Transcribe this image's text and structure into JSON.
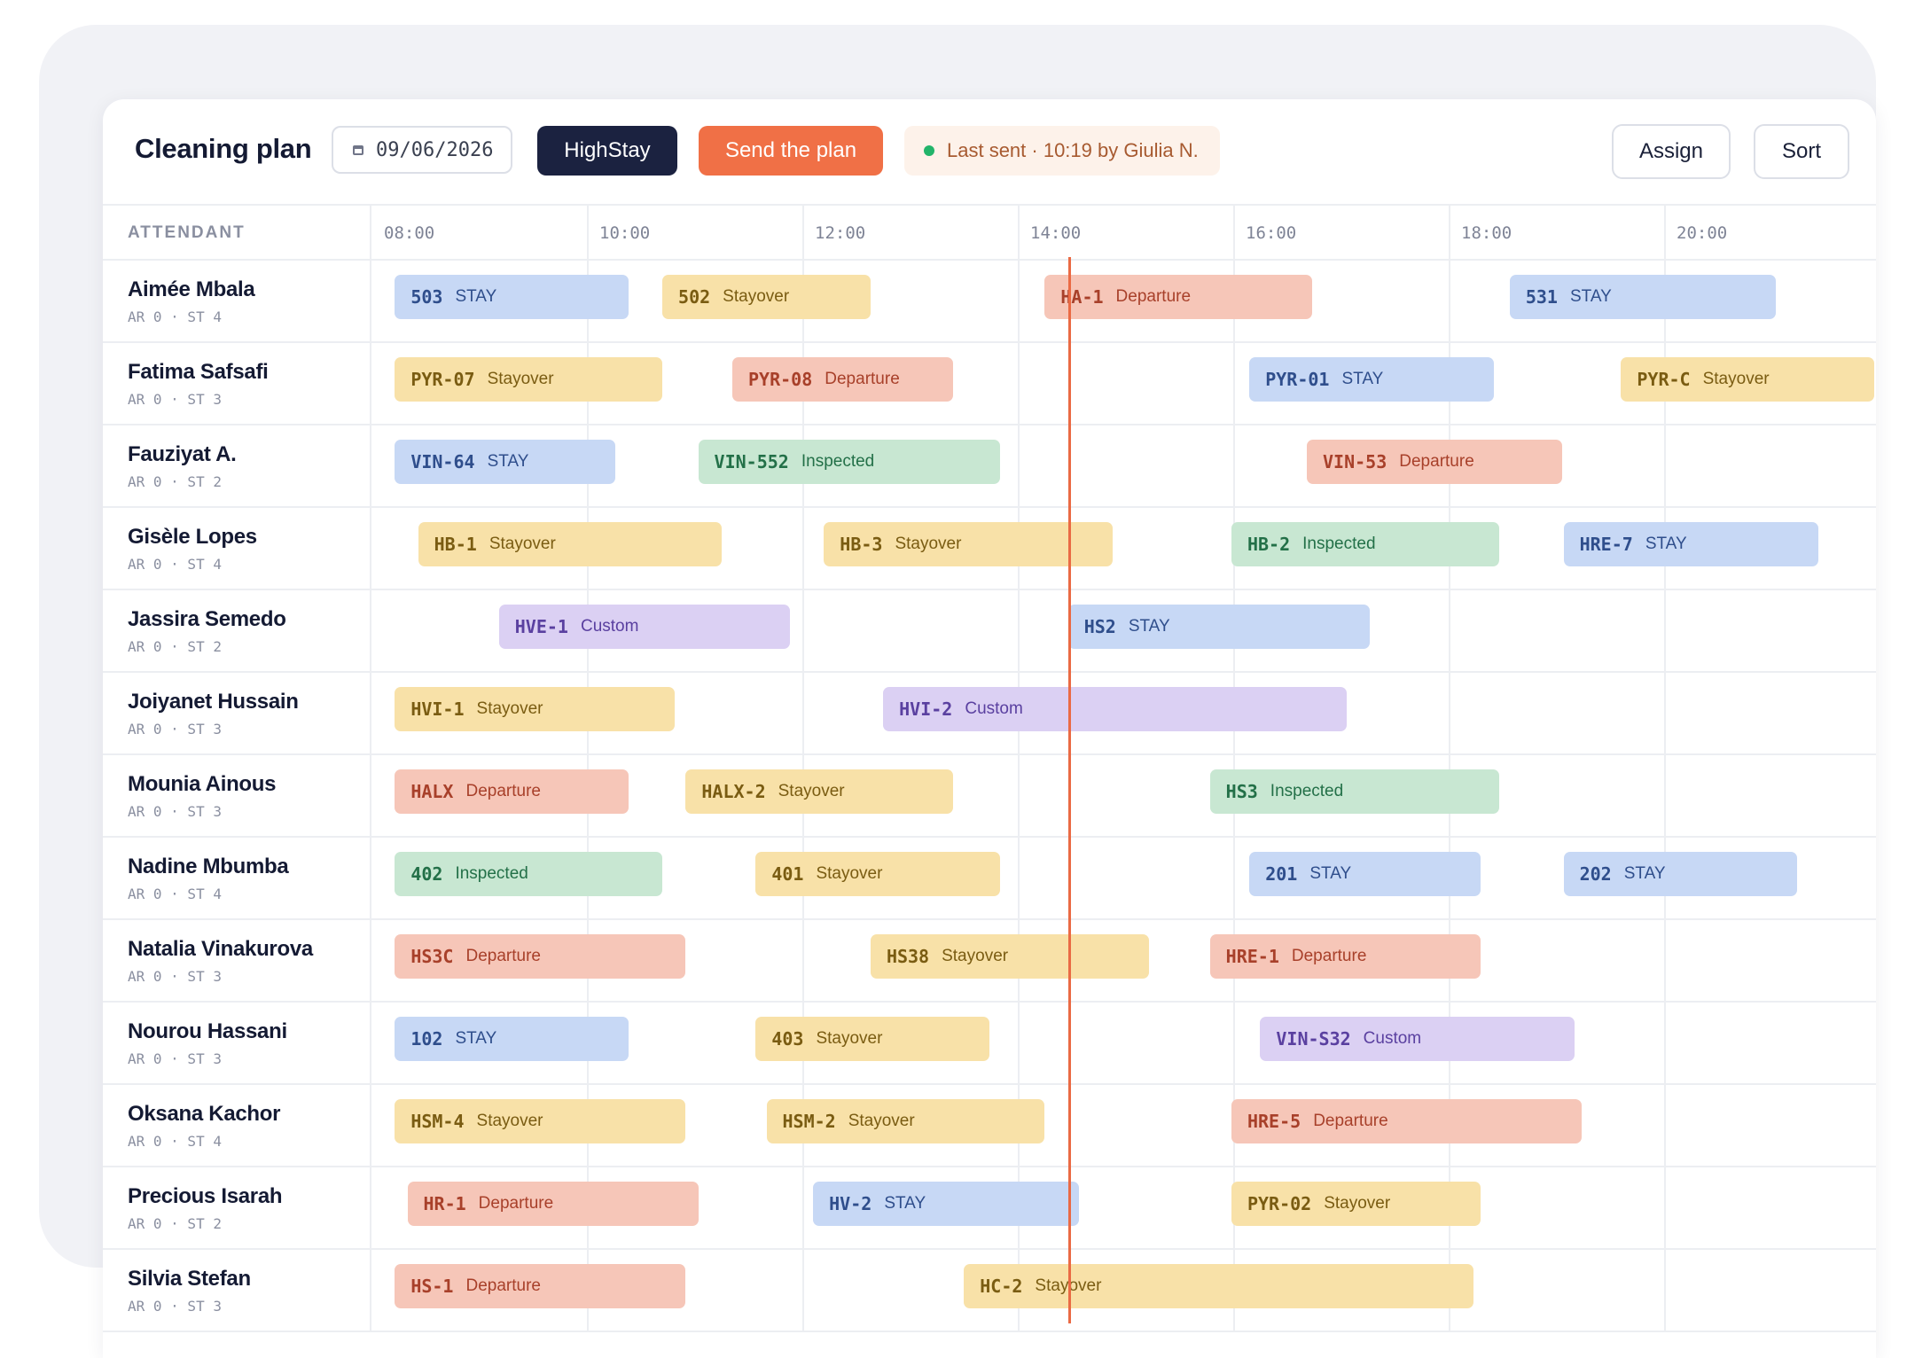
{
  "toolbar": {
    "title": "Cleaning plan",
    "date_value": "09/06/2026",
    "property_button": "HighStay",
    "send_button": "Send the plan",
    "last_sent": "Last sent · 10:19 by Giulia N.",
    "assign_button": "Assign",
    "sort_button": "Sort"
  },
  "header": {
    "attendant_label": "ATTENDANT",
    "times": [
      "08:00",
      "10:00",
      "12:00",
      "14:00",
      "16:00",
      "18:00",
      "20:00"
    ]
  },
  "legend_colors": {
    "STAY": "#c7d8f5",
    "Stayover": "#f8e1a8",
    "Departure": "#f6c6b8",
    "Inspected": "#c8e7d2",
    "Custom": "#dbd0f3",
    "current_time_line": "#ea6a44"
  },
  "attendants": [
    {
      "name": "Aimée Mbala",
      "meta": "AR 0 · ST 4",
      "tasks": [
        {
          "code": "503",
          "status": "STAY",
          "start": "08:13",
          "end": "10:23"
        },
        {
          "code": "502",
          "status": "Stayover",
          "start": "10:42",
          "end": "12:38"
        },
        {
          "code": "HA-1",
          "status": "Departure",
          "start": "14:15",
          "end": "16:44"
        },
        {
          "code": "531",
          "status": "STAY",
          "start": "18:34",
          "end": "21:02"
        }
      ]
    },
    {
      "name": "Fatima Safsafi",
      "meta": "AR 0 · ST 3",
      "tasks": [
        {
          "code": "PYR-07",
          "status": "Stayover",
          "start": "08:13",
          "end": "10:42"
        },
        {
          "code": "PYR-08",
          "status": "Departure",
          "start": "11:21",
          "end": "13:24"
        },
        {
          "code": "PYR-01",
          "status": "STAY",
          "start": "16:09",
          "end": "18:25"
        },
        {
          "code": "PYR-C",
          "status": "Stayover",
          "start": "19:36",
          "end": "21:57"
        }
      ]
    },
    {
      "name": "Fauziyat A.",
      "meta": "AR 0 · ST 2",
      "tasks": [
        {
          "code": "VIN-64",
          "status": "STAY",
          "start": "08:13",
          "end": "10:16"
        },
        {
          "code": "VIN-552",
          "status": "Inspected",
          "start": "11:02",
          "end": "13:50"
        },
        {
          "code": "VIN-53",
          "status": "Departure",
          "start": "16:41",
          "end": "19:03"
        }
      ]
    },
    {
      "name": "Gisèle Lopes",
      "meta": "AR 0 · ST 4",
      "tasks": [
        {
          "code": "HB-1",
          "status": "Stayover",
          "start": "08:26",
          "end": "11:15"
        },
        {
          "code": "HB-3",
          "status": "Stayover",
          "start": "12:12",
          "end": "14:53"
        },
        {
          "code": "HB-2",
          "status": "Inspected",
          "start": "15:59",
          "end": "18:28"
        },
        {
          "code": "HRE-7",
          "status": "STAY",
          "start": "19:04",
          "end": "21:26"
        }
      ]
    },
    {
      "name": "Jassira Semedo",
      "meta": "AR 0 · ST 2",
      "tasks": [
        {
          "code": "HVE-1",
          "status": "Custom",
          "start": "09:11",
          "end": "11:53"
        },
        {
          "code": "HS2",
          "status": "STAY",
          "start": "14:28",
          "end": "17:16"
        }
      ]
    },
    {
      "name": "Joiyanet Hussain",
      "meta": "AR 0 · ST 3",
      "tasks": [
        {
          "code": "HVI-1",
          "status": "Stayover",
          "start": "08:13",
          "end": "10:49"
        },
        {
          "code": "HVI-2",
          "status": "Custom",
          "start": "12:45",
          "end": "17:03"
        }
      ]
    },
    {
      "name": "Mounia Ainous",
      "meta": "AR 0 · ST 3",
      "tasks": [
        {
          "code": "HALX",
          "status": "Departure",
          "start": "08:13",
          "end": "10:23"
        },
        {
          "code": "HALX-2",
          "status": "Stayover",
          "start": "10:55",
          "end": "13:24"
        },
        {
          "code": "HS3",
          "status": "Inspected",
          "start": "15:47",
          "end": "18:28"
        }
      ]
    },
    {
      "name": "Nadine Mbumba",
      "meta": "AR 0 · ST 4",
      "tasks": [
        {
          "code": "402",
          "status": "Inspected",
          "start": "08:13",
          "end": "10:42"
        },
        {
          "code": "401",
          "status": "Stayover",
          "start": "11:34",
          "end": "13:50"
        },
        {
          "code": "201",
          "status": "STAY",
          "start": "16:09",
          "end": "18:18"
        },
        {
          "code": "202",
          "status": "STAY",
          "start": "19:04",
          "end": "21:14"
        }
      ]
    },
    {
      "name": "Natalia Vinakurova",
      "meta": "AR 0 · ST 3",
      "tasks": [
        {
          "code": "HS3C",
          "status": "Departure",
          "start": "08:13",
          "end": "10:55"
        },
        {
          "code": "HS38",
          "status": "Stayover",
          "start": "12:38",
          "end": "15:13"
        },
        {
          "code": "HRE-1",
          "status": "Departure",
          "start": "15:47",
          "end": "18:18"
        }
      ]
    },
    {
      "name": "Nourou Hassani",
      "meta": "AR 0 · ST 3",
      "tasks": [
        {
          "code": "102",
          "status": "STAY",
          "start": "08:13",
          "end": "10:23"
        },
        {
          "code": "403",
          "status": "Stayover",
          "start": "11:34",
          "end": "13:44"
        },
        {
          "code": "VIN-S32",
          "status": "Custom",
          "start": "16:15",
          "end": "19:10"
        }
      ]
    },
    {
      "name": "Oksana Kachor",
      "meta": "AR 0 · ST 4",
      "tasks": [
        {
          "code": "HSM-4",
          "status": "Stayover",
          "start": "08:13",
          "end": "10:55"
        },
        {
          "code": "HSM-2",
          "status": "Stayover",
          "start": "11:40",
          "end": "14:15"
        },
        {
          "code": "HRE-5",
          "status": "Departure",
          "start": "15:59",
          "end": "19:14"
        }
      ]
    },
    {
      "name": "Precious Isarah",
      "meta": "AR 0 · ST 2",
      "tasks": [
        {
          "code": "HR-1",
          "status": "Departure",
          "start": "08:20",
          "end": "11:02"
        },
        {
          "code": "HV-2",
          "status": "STAY",
          "start": "12:06",
          "end": "14:34"
        },
        {
          "code": "PYR-02",
          "status": "Stayover",
          "start": "15:59",
          "end": "18:18"
        }
      ]
    },
    {
      "name": "Silvia Stefan",
      "meta": "AR 0 · ST 3",
      "tasks": [
        {
          "code": "HS-1",
          "status": "Departure",
          "start": "08:13",
          "end": "10:55"
        },
        {
          "code": "HC-2",
          "status": "Stayover",
          "start": "13:30",
          "end": "18:14"
        }
      ]
    }
  ],
  "current_time": "14:28"
}
